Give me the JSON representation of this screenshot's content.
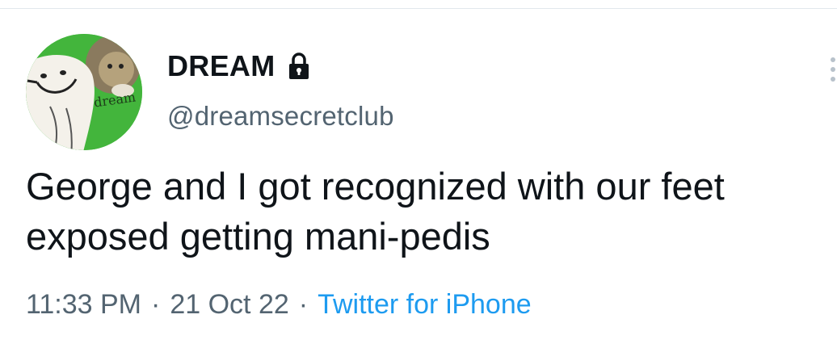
{
  "profile": {
    "display_name": "DREAM",
    "handle": "@dreamsecretclub",
    "avatar_text": "dream",
    "lock_icon": "lock-icon"
  },
  "tweet": {
    "text": "George and I got recognized with our feet exposed getting mani-pedis",
    "time": "11:33 PM",
    "separator": "·",
    "date": "21 Oct 22",
    "source": "Twitter for iPhone"
  },
  "colors": {
    "text_primary": "#0f1419",
    "text_secondary": "#536471",
    "link": "#1d9bf0",
    "avatar_bg": "#3fb63a"
  },
  "icons": {
    "more": "more-vertical-icon"
  }
}
